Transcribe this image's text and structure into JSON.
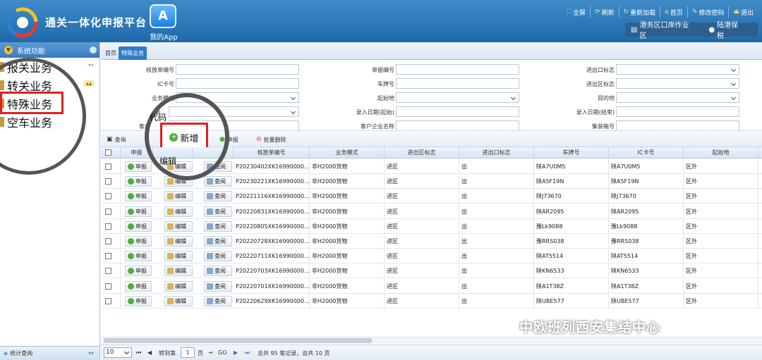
{
  "header": {
    "brand": "通关一体化申报平台",
    "app_label": "我的App",
    "app_icon_glyph": "A",
    "top_menu": [
      {
        "icon": "fullscreen-icon",
        "label": "全屏"
      },
      {
        "icon": "refresh-icon",
        "label": "刷新"
      },
      {
        "icon": "reload-icon",
        "label": "重新加载"
      },
      {
        "icon": "home-icon",
        "label": "首页"
      },
      {
        "icon": "key-icon",
        "label": "修改密码"
      },
      {
        "icon": "exit-icon",
        "label": "退出"
      }
    ],
    "location": "港务区口岸作业区",
    "user": "陆港保税"
  },
  "sidebar": {
    "title": "系统功能",
    "items": [
      {
        "label": "报关业务"
      },
      {
        "label": "转关业务"
      },
      {
        "label": "特殊业务"
      },
      {
        "label": "空车业务"
      }
    ],
    "footer": "统计查询"
  },
  "tabs": [
    {
      "label": "首页"
    },
    {
      "label": "特殊业务"
    }
  ],
  "form": {
    "fields": [
      {
        "label": "核放单编号",
        "type": "input"
      },
      {
        "label": "单据编号",
        "type": "input"
      },
      {
        "label": "进出口标志",
        "type": "select"
      },
      {
        "label": "IC卡号",
        "type": "input"
      },
      {
        "label": "车牌号",
        "type": "input"
      },
      {
        "label": "进出区标志",
        "type": "select"
      },
      {
        "label": "业务模式",
        "type": "select"
      },
      {
        "label": "起始地",
        "type": "select"
      },
      {
        "label": "目的地",
        "type": "select"
      },
      {
        "label": "申",
        "type": "select"
      },
      {
        "label": "录入日期(起始)",
        "type": "input"
      },
      {
        "label": "录入日期(结束)",
        "type": "input"
      },
      {
        "label": "客户",
        "type": "input"
      },
      {
        "label": "客户企业名称",
        "type": "input"
      },
      {
        "label": "集装箱号",
        "type": "input"
      }
    ]
  },
  "toolbar": {
    "query": "查询",
    "new": "新增",
    "declare": "申报",
    "batch_delete": "批量删除"
  },
  "callouts": {
    "code": "代码",
    "edit": "编辑"
  },
  "grid": {
    "headers": [
      "申报",
      "编辑",
      "查",
      "核放单编号",
      "业务模式",
      "进出区标志",
      "进出口标志",
      "车牌号",
      "IC卡号",
      "起始地"
    ],
    "btn_declare": "申报",
    "btn_edit": "编辑",
    "btn_view": "查阅",
    "rows": [
      {
        "id": "P20230402XK16990000...",
        "mode": "非H2000货物",
        "zone": "进区",
        "io": "出",
        "plate": "陕A7U0M5",
        "ic": "陕A7U0M5",
        "origin": "区外"
      },
      {
        "id": "P20230221XK16990000...",
        "mode": "非H2000货物",
        "zone": "进区",
        "io": "出",
        "plate": "陕A5F19N",
        "ic": "陕A5F19N",
        "origin": "区外"
      },
      {
        "id": "P20221116XK16990000...",
        "mode": "非H2000货物",
        "zone": "进区",
        "io": "出",
        "plate": "陕J73670",
        "ic": "陕J73670",
        "origin": "区外"
      },
      {
        "id": "P20220831XK16990000...",
        "mode": "非H2000货物",
        "zone": "进区",
        "io": "出",
        "plate": "陕AR2095",
        "ic": "陕AR2095",
        "origin": "区外"
      },
      {
        "id": "P20220805XK16990000...",
        "mode": "非H2000货物",
        "zone": "进区",
        "io": "出",
        "plate": "豫Lk9088",
        "ic": "豫Lk9088",
        "origin": "区外"
      },
      {
        "id": "P20220728XK16990000...",
        "mode": "非H2000货物",
        "zone": "进区",
        "io": "出",
        "plate": "豫RRS038",
        "ic": "豫RRS038",
        "origin": "区外"
      },
      {
        "id": "P20220711XK16990000...",
        "mode": "非H2000货物",
        "zone": "进区",
        "io": "出",
        "plate": "陕AT5514",
        "ic": "陕AT5514",
        "origin": "区外"
      },
      {
        "id": "P20220703XK16990000...",
        "mode": "非H2000货物",
        "zone": "进区",
        "io": "出",
        "plate": "陕KN6533",
        "ic": "陕KN6533",
        "origin": "区外"
      },
      {
        "id": "P20220701XK16990000...",
        "mode": "非H2000货物",
        "zone": "进区",
        "io": "出",
        "plate": "陕A1T38Z",
        "ic": "陕A1T38Z",
        "origin": "区外"
      },
      {
        "id": "P20220629XK16990000...",
        "mode": "非H2000货物",
        "zone": "进区",
        "io": "出",
        "plate": "陕UBE577",
        "ic": "陕UBE577",
        "origin": "区外"
      }
    ]
  },
  "pager": {
    "page_size": "10",
    "goto_label": "转到第",
    "page": "1",
    "page_unit": "页",
    "go": "GO",
    "summary": "总共 95 笔记录，总共 10 页"
  },
  "watermark": "中欧班列西安集结中心"
}
